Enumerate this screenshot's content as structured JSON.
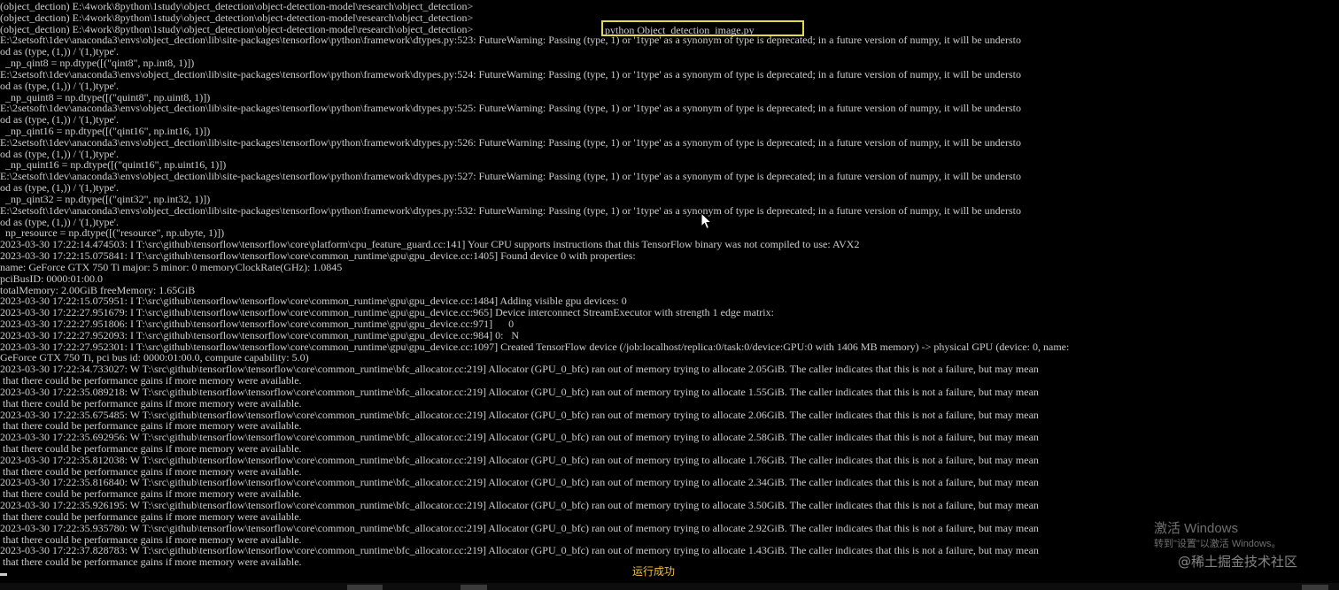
{
  "console": {
    "lines": [
      "(object_dection) E:\\4work\\8python\\1study\\object_detection\\object-detection-model\\research\\object_detection>",
      "(object_dection) E:\\4work\\8python\\1study\\object_detection\\object-detection-model\\research\\object_detection>",
      "(object_dection) E:\\4work\\8python\\1study\\object_detection\\object-detection-model\\research\\object_detection>",
      "E:\\2setsoft\\1dev\\anaconda3\\envs\\object_dection\\lib\\site-packages\\tensorflow\\python\\framework\\dtypes.py:523: FutureWarning: Passing (type, 1) or '1type' as a synonym of type is deprecated; in a future version of numpy, it will be understo",
      "od as (type, (1,)) / '(1,)type'.",
      "  _np_qint8 = np.dtype([(\"qint8\", np.int8, 1)])",
      "E:\\2setsoft\\1dev\\anaconda3\\envs\\object_dection\\lib\\site-packages\\tensorflow\\python\\framework\\dtypes.py:524: FutureWarning: Passing (type, 1) or '1type' as a synonym of type is deprecated; in a future version of numpy, it will be understo",
      "od as (type, (1,)) / '(1,)type'.",
      "  _np_quint8 = np.dtype([(\"quint8\", np.uint8, 1)])",
      "E:\\2setsoft\\1dev\\anaconda3\\envs\\object_dection\\lib\\site-packages\\tensorflow\\python\\framework\\dtypes.py:525: FutureWarning: Passing (type, 1) or '1type' as a synonym of type is deprecated; in a future version of numpy, it will be understo",
      "od as (type, (1,)) / '(1,)type'.",
      "  _np_qint16 = np.dtype([(\"qint16\", np.int16, 1)])",
      "E:\\2setsoft\\1dev\\anaconda3\\envs\\object_dection\\lib\\site-packages\\tensorflow\\python\\framework\\dtypes.py:526: FutureWarning: Passing (type, 1) or '1type' as a synonym of type is deprecated; in a future version of numpy, it will be understo",
      "od as (type, (1,)) / '(1,)type'.",
      "  _np_quint16 = np.dtype([(\"quint16\", np.uint16, 1)])",
      "E:\\2setsoft\\1dev\\anaconda3\\envs\\object_dection\\lib\\site-packages\\tensorflow\\python\\framework\\dtypes.py:527: FutureWarning: Passing (type, 1) or '1type' as a synonym of type is deprecated; in a future version of numpy, it will be understo",
      "od as (type, (1,)) / '(1,)type'.",
      "  _np_qint32 = np.dtype([(\"qint32\", np.int32, 1)])",
      "E:\\2setsoft\\1dev\\anaconda3\\envs\\object_dection\\lib\\site-packages\\tensorflow\\python\\framework\\dtypes.py:532: FutureWarning: Passing (type, 1) or '1type' as a synonym of type is deprecated; in a future version of numpy, it will be understo",
      "od as (type, (1,)) / '(1,)type'.",
      "  np_resource = np.dtype([(\"resource\", np.ubyte, 1)])",
      "2023-03-30 17:22:14.474503: I T:\\src\\github\\tensorflow\\tensorflow\\core\\platform\\cpu_feature_guard.cc:141] Your CPU supports instructions that this TensorFlow binary was not compiled to use: AVX2",
      "2023-03-30 17:22:15.075841: I T:\\src\\github\\tensorflow\\tensorflow\\core\\common_runtime\\gpu\\gpu_device.cc:1405] Found device 0 with properties:",
      "name: GeForce GTX 750 Ti major: 5 minor: 0 memoryClockRate(GHz): 1.0845",
      "pciBusID: 0000:01:00.0",
      "totalMemory: 2.00GiB freeMemory: 1.65GiB",
      "2023-03-30 17:22:15.075951: I T:\\src\\github\\tensorflow\\tensorflow\\core\\common_runtime\\gpu\\gpu_device.cc:1484] Adding visible gpu devices: 0",
      "2023-03-30 17:22:27.951679: I T:\\src\\github\\tensorflow\\tensorflow\\core\\common_runtime\\gpu\\gpu_device.cc:965] Device interconnect StreamExecutor with strength 1 edge matrix:",
      "2023-03-30 17:22:27.951806: I T:\\src\\github\\tensorflow\\tensorflow\\core\\common_runtime\\gpu\\gpu_device.cc:971]      0",
      "2023-03-30 17:22:27.952093: I T:\\src\\github\\tensorflow\\tensorflow\\core\\common_runtime\\gpu\\gpu_device.cc:984] 0:   N",
      "2023-03-30 17:22:27.952301: I T:\\src\\github\\tensorflow\\tensorflow\\core\\common_runtime\\gpu\\gpu_device.cc:1097] Created TensorFlow device (/job:localhost/replica:0/task:0/device:GPU:0 with 1406 MB memory) -> physical GPU (device: 0, name:",
      "GeForce GTX 750 Ti, pci bus id: 0000:01:00.0, compute capability: 5.0)",
      "2023-03-30 17:22:34.733027: W T:\\src\\github\\tensorflow\\tensorflow\\core\\common_runtime\\bfc_allocator.cc:219] Allocator (GPU_0_bfc) ran out of memory trying to allocate 2.05GiB. The caller indicates that this is not a failure, but may mean",
      " that there could be performance gains if more memory were available.",
      "2023-03-30 17:22:35.089218: W T:\\src\\github\\tensorflow\\tensorflow\\core\\common_runtime\\bfc_allocator.cc:219] Allocator (GPU_0_bfc) ran out of memory trying to allocate 1.55GiB. The caller indicates that this is not a failure, but may mean",
      " that there could be performance gains if more memory were available.",
      "2023-03-30 17:22:35.675485: W T:\\src\\github\\tensorflow\\tensorflow\\core\\common_runtime\\bfc_allocator.cc:219] Allocator (GPU_0_bfc) ran out of memory trying to allocate 2.06GiB. The caller indicates that this is not a failure, but may mean",
      " that there could be performance gains if more memory were available.",
      "2023-03-30 17:22:35.692956: W T:\\src\\github\\tensorflow\\tensorflow\\core\\common_runtime\\bfc_allocator.cc:219] Allocator (GPU_0_bfc) ran out of memory trying to allocate 2.58GiB. The caller indicates that this is not a failure, but may mean",
      " that there could be performance gains if more memory were available.",
      "2023-03-30 17:22:35.812038: W T:\\src\\github\\tensorflow\\tensorflow\\core\\common_runtime\\bfc_allocator.cc:219] Allocator (GPU_0_bfc) ran out of memory trying to allocate 1.76GiB. The caller indicates that this is not a failure, but may mean",
      " that there could be performance gains if more memory were available.",
      "2023-03-30 17:22:35.816840: W T:\\src\\github\\tensorflow\\tensorflow\\core\\common_runtime\\bfc_allocator.cc:219] Allocator (GPU_0_bfc) ran out of memory trying to allocate 2.34GiB. The caller indicates that this is not a failure, but may mean",
      " that there could be performance gains if more memory were available.",
      "2023-03-30 17:22:35.926195: W T:\\src\\github\\tensorflow\\tensorflow\\core\\common_runtime\\bfc_allocator.cc:219] Allocator (GPU_0_bfc) ran out of memory trying to allocate 3.50GiB. The caller indicates that this is not a failure, but may mean",
      " that there could be performance gains if more memory were available.",
      "2023-03-30 17:22:35.935780: W T:\\src\\github\\tensorflow\\tensorflow\\core\\common_runtime\\bfc_allocator.cc:219] Allocator (GPU_0_bfc) ran out of memory trying to allocate 2.92GiB. The caller indicates that this is not a failure, but may mean",
      " that there could be performance gains if more memory were available.",
      "2023-03-30 17:22:37.828783: W T:\\src\\github\\tensorflow\\tensorflow\\core\\common_runtime\\bfc_allocator.cc:219] Allocator (GPU_0_bfc) ran out of memory trying to allocate 1.43GiB. The caller indicates that this is not a failure, but may mean",
      " that there could be performance gains if more memory were available."
    ],
    "highlighted_command": "python Object_detection_image.py"
  },
  "status_caption": "运行成功",
  "windows_activation": {
    "line1": "激活 Windows",
    "line2": "转到\"设置\"以激活 Windows。"
  },
  "site_watermark": "@稀土掘金技术社区",
  "colors": {
    "background": "#000000",
    "console_text": "#cccccc",
    "highlight_border": "#e6d94a",
    "status_caption": "#f0c040"
  },
  "icons": {
    "mouse_pointer": "arrow-cursor-icon",
    "text_cursor": "text-cursor-icon"
  }
}
